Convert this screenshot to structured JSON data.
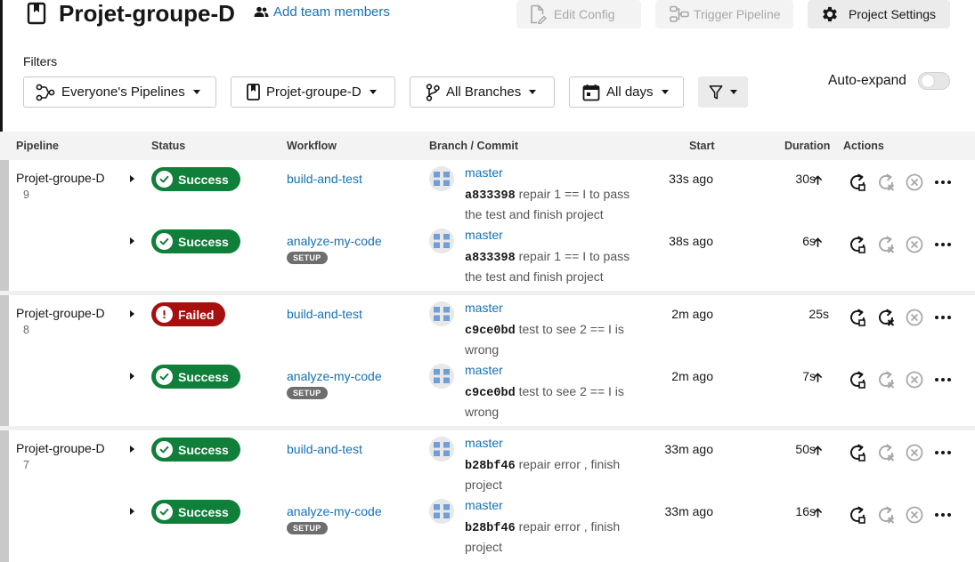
{
  "header": {
    "project_title": "Projet-groupe-D",
    "add_team_label": "Add team members",
    "edit_config_label": "Edit Config",
    "trigger_pipeline_label": "Trigger Pipeline",
    "project_settings_label": "Project Settings"
  },
  "filters": {
    "label": "Filters",
    "pipelines": "Everyone's Pipelines",
    "project": "Projet-groupe-D",
    "branches": "All Branches",
    "days": "All days",
    "auto_expand_label": "Auto-expand",
    "auto_expand_on": false
  },
  "table": {
    "columns": [
      "Pipeline",
      "Status",
      "Workflow",
      "Branch / Commit",
      "Start",
      "Duration",
      "Actions"
    ]
  },
  "colors": {
    "success": "#0f7f3a",
    "failed": "#a80f0f",
    "link": "#1471b5"
  },
  "pipelines": [
    {
      "name": "Projet-groupe-D",
      "number": "9",
      "workflows": [
        {
          "status": "Success",
          "workflow": "build-and-test",
          "setup": "",
          "branch": "master",
          "hash": "a833398",
          "message": "repair 1 == I to pass the test and finish project",
          "start": "33s ago",
          "duration": "30s"
        },
        {
          "status": "Success",
          "workflow": "analyze-my-code",
          "setup": "SETUP",
          "branch": "master",
          "hash": "a833398",
          "message": "repair 1 == I to pass the test and finish project",
          "start": "38s ago",
          "duration": "6s"
        }
      ]
    },
    {
      "name": "Projet-groupe-D",
      "number": "8",
      "workflows": [
        {
          "status": "Failed",
          "workflow": "build-and-test",
          "setup": "",
          "branch": "master",
          "hash": "c9ce0bd",
          "message": "test to see 2 == I is wrong",
          "start": "2m ago",
          "duration": "25s"
        },
        {
          "status": "Success",
          "workflow": "analyze-my-code",
          "setup": "SETUP",
          "branch": "master",
          "hash": "c9ce0bd",
          "message": "test to see 2 == I is wrong",
          "start": "2m ago",
          "duration": "7s"
        }
      ]
    },
    {
      "name": "Projet-groupe-D",
      "number": "7",
      "workflows": [
        {
          "status": "Success",
          "workflow": "build-and-test",
          "setup": "",
          "branch": "master",
          "hash": "b28bf46",
          "message": "repair error , finish project",
          "start": "33m ago",
          "duration": "50s"
        },
        {
          "status": "Success",
          "workflow": "analyze-my-code",
          "setup": "SETUP",
          "branch": "master",
          "hash": "b28bf46",
          "message": "repair error , finish project",
          "start": "33m ago",
          "duration": "16s"
        }
      ]
    }
  ]
}
